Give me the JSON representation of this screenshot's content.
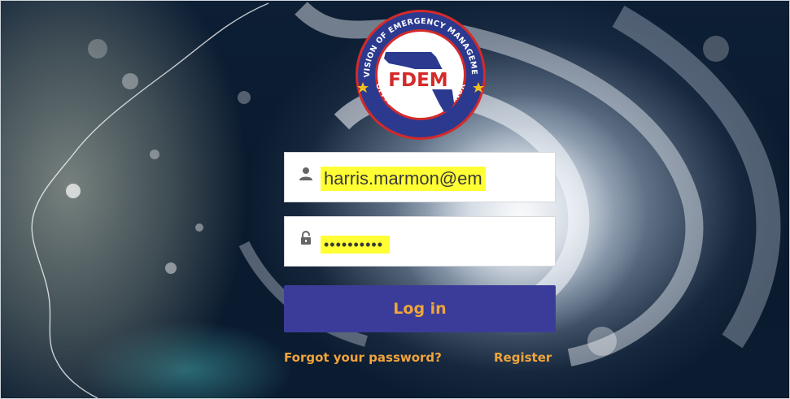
{
  "logo": {
    "top_arc": "DIVISION OF EMERGENCY MANAGEMENT",
    "bottom_arc": "OFFICE OF THE GOVERNOR",
    "abbreviation": "FDEM"
  },
  "login": {
    "username_value": "harris.marmon@em",
    "password_value": "••••••••••",
    "username_icon": "user-icon",
    "password_icon": "lock-icon",
    "button_label": "Log in"
  },
  "links": {
    "forgot": "Forgot your password?",
    "register": "Register"
  },
  "colors": {
    "button_bg": "#3b3c9a",
    "accent_text": "#f0a43c",
    "highlight": "#ffff33",
    "logo_blue": "#2b3a8f",
    "logo_red": "#d42a2a"
  }
}
